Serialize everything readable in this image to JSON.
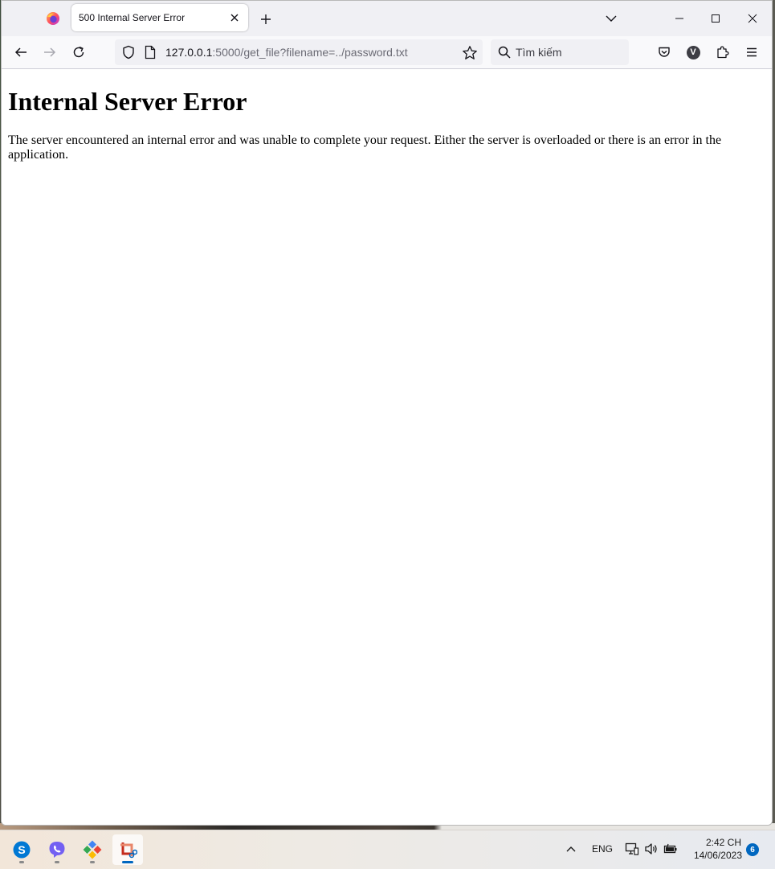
{
  "browser": {
    "tab": {
      "title": "500 Internal Server Error"
    },
    "url": {
      "host": "127.0.0.1",
      "rest": ":5000/get_file?filename=../password.txt"
    },
    "search": {
      "placeholder": "Tìm kiếm"
    },
    "account_initial": "V"
  },
  "page": {
    "heading": "Internal Server Error",
    "message": "The server encountered an internal error and was unable to complete your request. Either the server is overloaded or there is an error in the application."
  },
  "taskbar": {
    "apps": [
      {
        "name": "Skype",
        "icon": "skype-icon",
        "color": "#0078d4"
      },
      {
        "name": "Viber",
        "icon": "viber-icon",
        "color": "#7360f2"
      },
      {
        "name": "Gemini",
        "icon": "gemini-icon",
        "color": "#4285f4"
      },
      {
        "name": "Snipping Tool",
        "icon": "snipping-tool-icon",
        "color": "#c42b1c",
        "active": true
      }
    ],
    "language": "ENG",
    "time": "2:42 CH",
    "date": "14/06/2023",
    "notifications": "6"
  },
  "colors": {
    "accent": "#0067c0",
    "chrome": "#f0f0f4",
    "toolbar": "#f9f9fb"
  }
}
